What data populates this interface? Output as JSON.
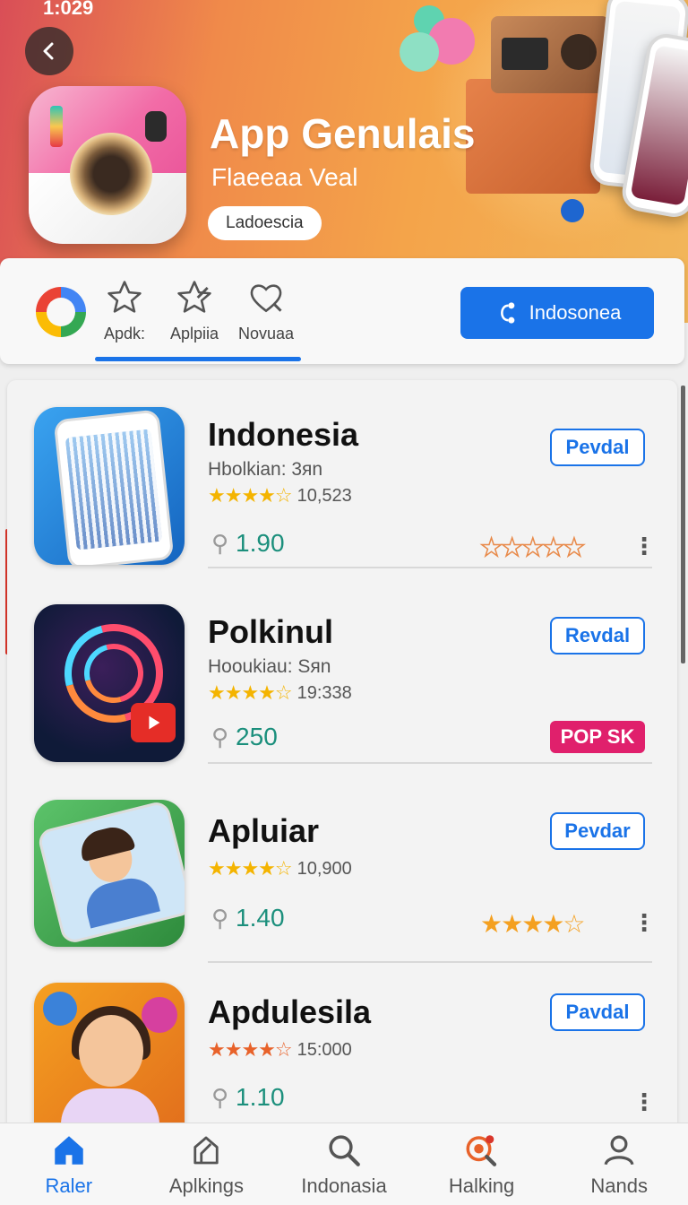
{
  "status_bar": {
    "time": "1:029"
  },
  "hero": {
    "title": "App Genulais",
    "subtitle": "Flaeeaa Veal",
    "pill_label": "Ladoescia"
  },
  "tabs": [
    {
      "label": "Apdk:",
      "icon": "star-icon"
    },
    {
      "label": "Aplpiia",
      "icon": "star-edit-icon"
    },
    {
      "label": "Novuaa",
      "icon": "heart-icon"
    }
  ],
  "share_button": {
    "label": "Indosonea",
    "icon": "share-icon"
  },
  "apps": [
    {
      "name": "Indonesia",
      "developer": "Hbolkian: 3яn",
      "stars": "★★★★☆",
      "rating_count": "10,523",
      "size": "1.90",
      "action": "Pevdal",
      "extra": "stars-outline"
    },
    {
      "name": "Polkinul",
      "developer": "Hooukiau: Sяn",
      "stars": "★★★★☆",
      "rating_count": "19:338",
      "size": "250",
      "action": "Revdal",
      "badge": "POP SK"
    },
    {
      "name": "Apluiar",
      "developer": "",
      "stars": "★★★★☆",
      "rating_count": "10,900",
      "size": "1.40",
      "action": "Pevdar",
      "extra": "stars-filled"
    },
    {
      "name": "Apdulesila",
      "developer": "",
      "stars": "★★★★☆",
      "rating_count": "15:000",
      "size": "1.10",
      "action": "Pavdal"
    }
  ],
  "bottom_nav": [
    {
      "label": "Raler",
      "icon": "home-icon",
      "active": true
    },
    {
      "label": "Aplkings",
      "icon": "house-outline-icon",
      "active": false
    },
    {
      "label": "Indonasia",
      "icon": "search-icon",
      "active": false
    },
    {
      "label": "Halking",
      "icon": "target-search-icon",
      "active": false
    },
    {
      "label": "Nands",
      "icon": "person-icon",
      "active": false
    }
  ],
  "colors": {
    "accent": "#1a73e8",
    "size_text": "#1b8f7c",
    "badge": "#e0206c",
    "star": "#f4b400"
  }
}
